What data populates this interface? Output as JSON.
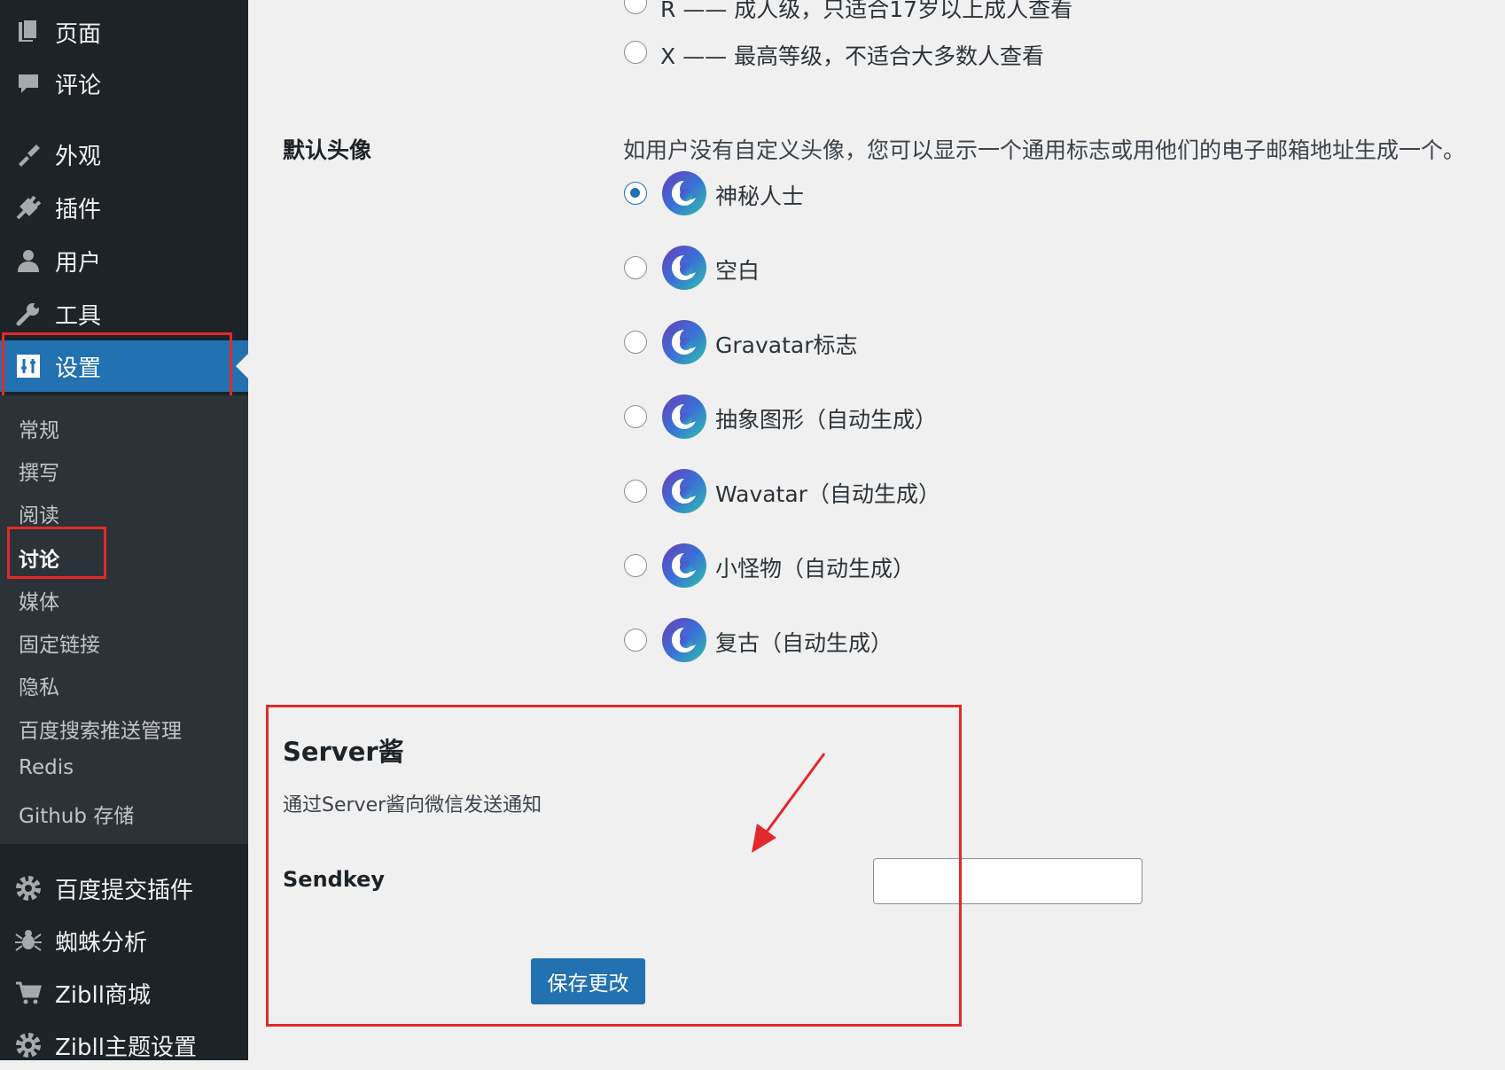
{
  "sidebar": {
    "items": [
      {
        "label": "页面",
        "icon": "page-icon"
      },
      {
        "label": "评论",
        "icon": "comment-icon"
      },
      {
        "label": "外观",
        "icon": "brush-icon"
      },
      {
        "label": "插件",
        "icon": "plugin-icon"
      },
      {
        "label": "用户",
        "icon": "user-icon"
      },
      {
        "label": "工具",
        "icon": "wrench-icon"
      },
      {
        "label": "设置",
        "icon": "settings-icon"
      }
    ],
    "submenu": [
      "常规",
      "撰写",
      "阅读",
      "讨论",
      "媒体",
      "固定链接",
      "隐私",
      "百度搜索推送管理",
      "Redis",
      "Github 存储"
    ],
    "bottom_items": [
      {
        "label": "百度提交插件",
        "icon": "gear-icon"
      },
      {
        "label": "蜘蛛分析",
        "icon": "spider-icon"
      },
      {
        "label": "Zibll商城",
        "icon": "cart-icon"
      },
      {
        "label": "Zibll主题设置",
        "icon": "gear-icon"
      }
    ]
  },
  "ratings": {
    "r": "R —— 成人级，只适合17岁以上成人查看",
    "x": "X —— 最高等级，不适合大多数人查看"
  },
  "default_avatar": {
    "heading": "默认头像",
    "description": "如用户没有自定义头像，您可以显示一个通用标志或用他们的电子邮箱地址生成一个。",
    "options": [
      "神秘人士",
      "空白",
      "Gravatar标志",
      "抽象图形（自动生成）",
      "Wavatar（自动生成）",
      "小怪物（自动生成）",
      "复古（自动生成）"
    ],
    "selected_index": 0
  },
  "serverchan": {
    "title": "Server酱",
    "description": "通过Server酱向微信发送通知",
    "sendkey_label": "Sendkey",
    "sendkey_value": ""
  },
  "save_label": "保存更改",
  "colors": {
    "sidebar": "#1d2327",
    "accent": "#2271b1",
    "highlight": "#e3292b"
  }
}
